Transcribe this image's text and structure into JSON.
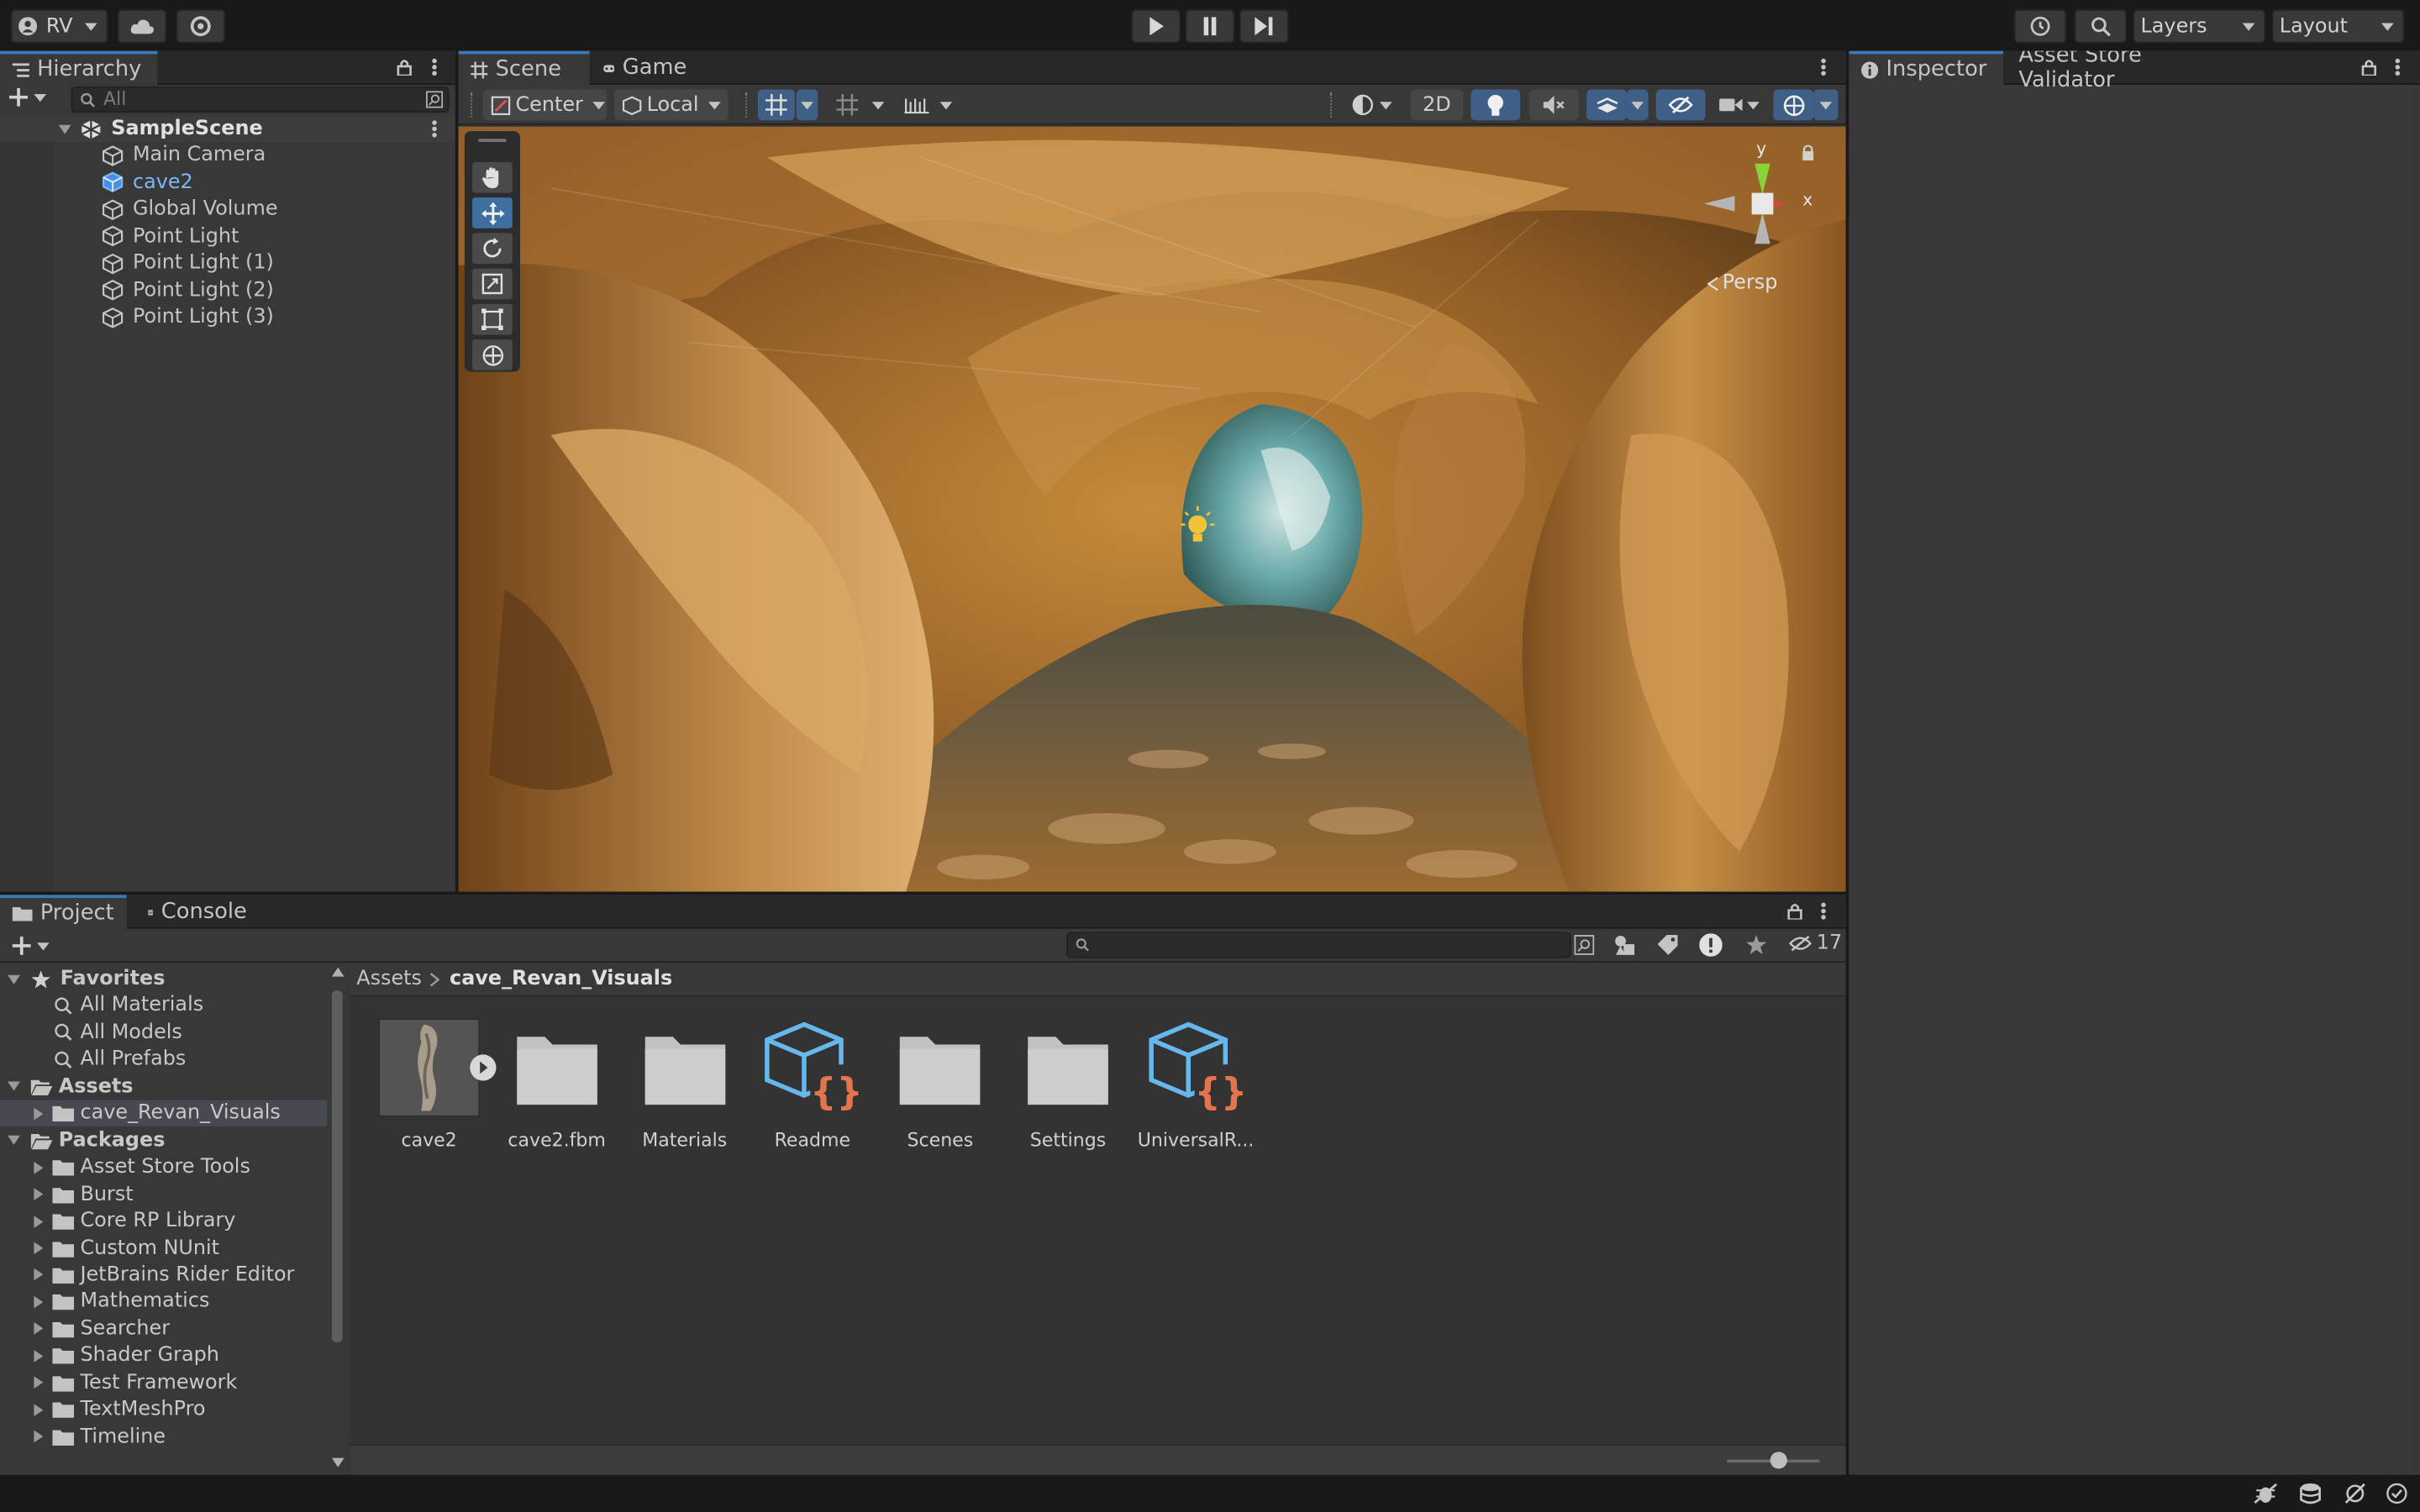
{
  "toolbar": {
    "account_label": "RV",
    "layers_label": "Layers",
    "layout_label": "Layout",
    "play_icon": "play-icon",
    "pause_icon": "pause-icon",
    "step_icon": "step-icon"
  },
  "hierarchy": {
    "tab_label": "Hierarchy",
    "search_placeholder": "All",
    "scene_name": "SampleScene",
    "items": [
      {
        "label": "Main Camera",
        "selected": false
      },
      {
        "label": "cave2",
        "selected": true
      },
      {
        "label": "Global Volume",
        "selected": false
      },
      {
        "label": "Point Light",
        "selected": false
      },
      {
        "label": "Point Light (1)",
        "selected": false
      },
      {
        "label": "Point Light (2)",
        "selected": false
      },
      {
        "label": "Point Light (3)",
        "selected": false
      }
    ]
  },
  "scene": {
    "tabs": [
      {
        "label": "Scene"
      },
      {
        "label": "Game"
      }
    ],
    "pivot_label": "Center",
    "space_label": "Local",
    "mode_2d_label": "2D",
    "gizmo_y": "y",
    "gizmo_x": "x",
    "persp_label": "Persp"
  },
  "inspector": {
    "tabs": [
      {
        "label": "Inspector"
      },
      {
        "label": "Asset Store Validator"
      }
    ]
  },
  "project": {
    "tabs": [
      {
        "label": "Project"
      },
      {
        "label": "Console"
      }
    ],
    "hidden_count": "17",
    "breadcrumb": [
      "Assets",
      "cave_Revan_Visuals"
    ],
    "favorites": {
      "label": "Favorites",
      "items": [
        "All Materials",
        "All Models",
        "All Prefabs"
      ]
    },
    "assets_root": {
      "label": "Assets",
      "items": [
        "cave_Revan_Visuals"
      ]
    },
    "packages": {
      "label": "Packages",
      "items": [
        "Asset Store Tools",
        "Burst",
        "Core RP Library",
        "Custom NUnit",
        "JetBrains Rider Editor",
        "Mathematics",
        "Searcher",
        "Shader Graph",
        "Test Framework",
        "TextMeshPro",
        "Timeline"
      ]
    },
    "assets": [
      {
        "label": "cave2",
        "kind": "model"
      },
      {
        "label": "cave2.fbm",
        "kind": "folder"
      },
      {
        "label": "Materials",
        "kind": "folder"
      },
      {
        "label": "Readme",
        "kind": "script-asset"
      },
      {
        "label": "Scenes",
        "kind": "folder"
      },
      {
        "label": "Settings",
        "kind": "folder"
      },
      {
        "label": "UniversalR...",
        "kind": "script-asset"
      }
    ]
  },
  "colors": {
    "accent": "#3a79bb",
    "selected_text": "#7fb4f5",
    "panel": "#383838",
    "background": "#191919"
  }
}
